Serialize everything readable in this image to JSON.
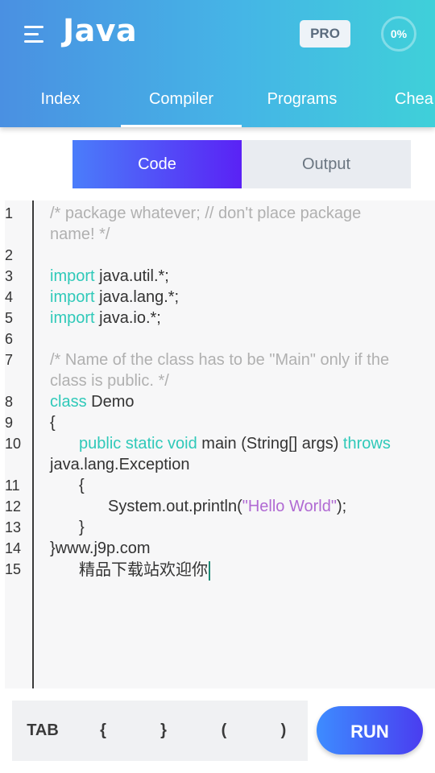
{
  "header": {
    "title": "Java",
    "pro_label": "PRO",
    "progress": "0%",
    "menu_icon": "hamburger-menu-icon"
  },
  "tabs": [
    {
      "label": "Index"
    },
    {
      "label": "Compiler"
    },
    {
      "label": "Programs"
    },
    {
      "label": "Chea"
    }
  ],
  "active_tab": "Compiler",
  "segment": {
    "code_label": "Code",
    "output_label": "Output",
    "selected": "Code"
  },
  "editor": {
    "line_numbers": [
      "1",
      "2",
      "3",
      "4",
      "5",
      "6",
      "7",
      "8",
      "9",
      "10",
      "11",
      "12",
      "13",
      "14",
      "15"
    ],
    "lines": {
      "l1a": "/* package whatever; // don't place package",
      "l1b": "name! */",
      "l3_kw": "import",
      "l3_rest": " java.util.*;",
      "l4_kw": "import",
      "l4_rest": " java.lang.*;",
      "l5_kw": "import",
      "l5_rest": " java.io.*;",
      "l7a": "/* Name of the class has to be \"Main\" only if the",
      "l7b": "class is public. */",
      "l8_kw": "class",
      "l8_rest": " Demo",
      "l9": "{",
      "l10_kw": "public static void",
      "l10_mid": " main (String[] args) ",
      "l10_kw2": "throws",
      "l10b": "java.lang.Exception",
      "l11": "{",
      "l12_pre": "System.out.println(",
      "l12_str": "\"Hello World\"",
      "l12_post": ");",
      "l13": "}",
      "l14": "}www.j9p.com",
      "l15": "精品下载站欢迎你"
    },
    "colors": {
      "keyword": "#2fc9b9",
      "comment": "#b0b0b0",
      "string": "#b06ad3"
    }
  },
  "keybar": {
    "tab": "TAB",
    "lbrace": "{",
    "rbrace": "}",
    "lparen": "(",
    "rparen": ")"
  },
  "run_label": "RUN"
}
